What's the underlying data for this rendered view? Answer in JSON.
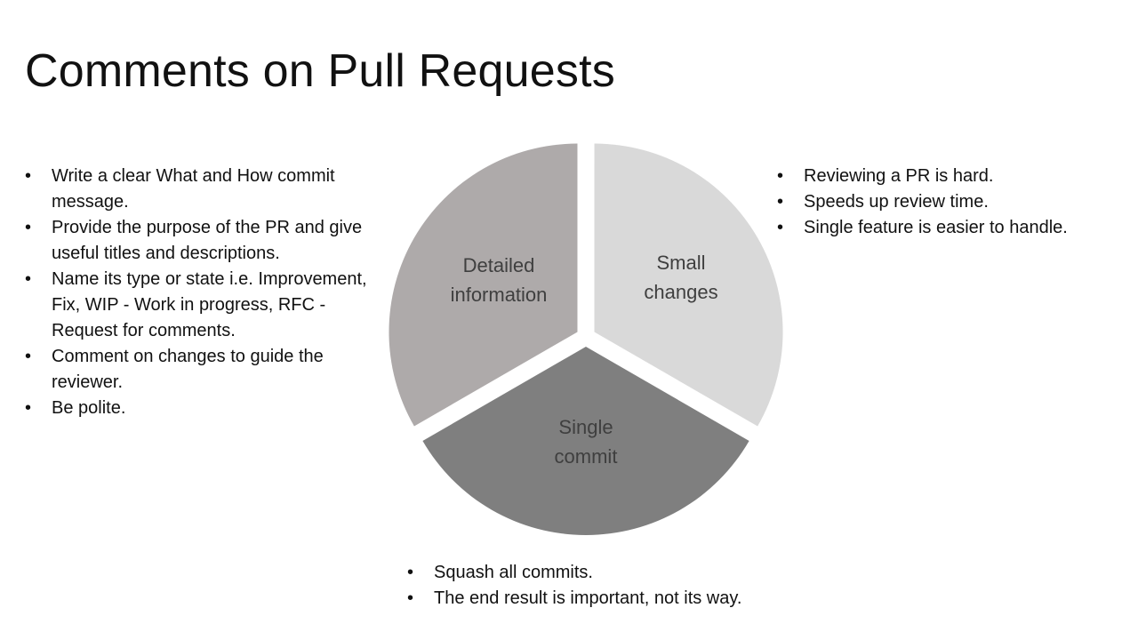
{
  "slide": {
    "title": "Comments on Pull Requests"
  },
  "diagram": {
    "segments": [
      {
        "id": "small-changes",
        "label_lines": [
          "Small",
          "changes"
        ],
        "color": "#d9d9d9"
      },
      {
        "id": "single-commit",
        "label_lines": [
          "Single",
          "commit"
        ],
        "color": "#7f7f7f"
      },
      {
        "id": "detailed-information",
        "label_lines": [
          "Detailed",
          "information"
        ],
        "color": "#aeaaaa"
      }
    ],
    "label_color": "#3f3f3f"
  },
  "bullets": {
    "detailed_information": [
      "Write a clear What and How commit message.",
      "Provide the purpose of the PR and give useful titles and descriptions.",
      "Name its type or state i.e. Improvement, Fix, WIP - Work in progress, RFC - Request for comments.",
      "Comment on changes to guide the reviewer.",
      "Be polite."
    ],
    "small_changes": [
      "Reviewing a PR is hard.",
      "Speeds up review time.",
      "Single feature is easier to handle."
    ],
    "single_commit": [
      "Squash all commits.",
      "The end result is important, not its way."
    ]
  }
}
